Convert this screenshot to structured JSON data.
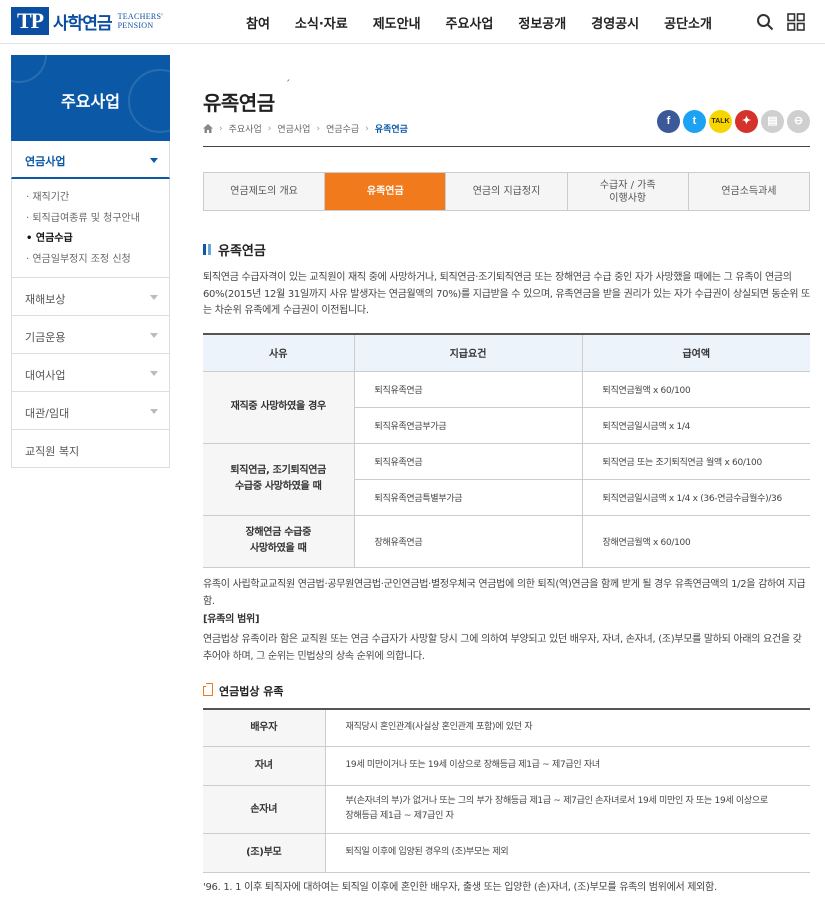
{
  "header": {
    "logo_mark": "TP",
    "logo_ko": "사학연금",
    "logo_en_1": "TEACHERS'",
    "logo_en_2": "PENSION",
    "nav": [
      "참여",
      "소식·자료",
      "제도안내",
      "주요사업",
      "정보공개",
      "경영공시",
      "공단소개"
    ]
  },
  "sidebar": {
    "title": "주요사업",
    "active_menu": "연금사업",
    "sub_items": [
      "· 재직기간",
      "· 퇴직급여종류 및 청구안내",
      "• 연금수급",
      "· 연금일부정지 조정 신청"
    ],
    "menus": [
      "재해보상",
      "기금운용",
      "대여사업",
      "대관/임대",
      "교직원 복지"
    ]
  },
  "page": {
    "title": "유족연금",
    "title_mark": "ˊ",
    "breadcrumb": [
      "주요사업",
      "연금사업",
      "연금수급",
      "유족연금"
    ]
  },
  "share": {
    "facebook": "f",
    "twitter": "t",
    "kakao": "TALK",
    "pdf": "✦",
    "print": "▤",
    "more": "⊖",
    "colors": {
      "facebook": "#3b5998",
      "twitter": "#1da1f2",
      "kakao": "#f7d600",
      "pdf": "#d4332c",
      "gray": "#cfcfcf"
    }
  },
  "tabs": [
    "연금제도의 개요",
    "유족연금",
    "연금의 지급정지",
    "수급자 / 가족\n이행사항",
    "연금소득과세"
  ],
  "section": {
    "title": "유족연금",
    "intro": "퇴직연금 수급자격이 있는 교직원이 재직 중에 사망하거나, 퇴직연금·조기퇴직연금 또는 장해연금 수급 중인 자가 사망했을 때에는 그 유족이 연금의 60%(2015년 12월 31일까지 사유 발생자는 연금월액의 70%)를 지급받을 수 있으며, 유족연금을 받을 권리가 있는 자가 수급권이 상실되면 동순위 또는 차순위 유족에게 수급권이 이전됩니다."
  },
  "table1": {
    "headers": [
      "사유",
      "지급요건",
      "급여액"
    ],
    "groups": [
      {
        "reason": "재직중 사망하였을 경우",
        "rows": [
          {
            "req": "퇴직유족연금",
            "amount": "퇴직연금월액 x 60/100"
          },
          {
            "req": "퇴직유족연금부가금",
            "amount": "퇴직연금일시금액 x 1/4"
          }
        ]
      },
      {
        "reason": "퇴직연금, 조기퇴직연금\n수급중 사망하였을 때",
        "rows": [
          {
            "req": "퇴직유족연금",
            "amount": "퇴직연금 또는 조기퇴직연금 월액 x 60/100"
          },
          {
            "req": "퇴직유족연금특별부가금",
            "amount": "퇴직연금일시금액 x 1/4 x (36-연금수급월수)/36"
          }
        ]
      },
      {
        "reason": "장해연금 수급중\n사망하였을 때",
        "rows": [
          {
            "req": "장해유족연금",
            "amount": "장해연금월액 x 60/100"
          }
        ]
      }
    ]
  },
  "notes": {
    "note1": "유족이 사립학교교직원 연금법·공무원연금법·군인연금법·별정우체국 연금법에 의한 퇴직(역)연금을 함께 받게 될 경우 유족연금액의 1/2을 감하여 지급함.",
    "scope_title": "[유족의 범위]",
    "scope_text": "연금법상 유족이라 함은 교직원 또는 연금 수급자가 사망할 당시 그에 의하여 부양되고 있던 배우자, 자녀, 손자녀, (조)부모를 말하되 아래의 요건을 갖추어야 하며, 그 순위는 민법상의 상속 순위에 의합니다."
  },
  "subsection": {
    "title": "연금법상 유족"
  },
  "table2": [
    {
      "label": "배우자",
      "desc": "재직당시 혼인관계(사실상 혼인관계 포함)에 있던 자"
    },
    {
      "label": "자녀",
      "desc": "19세 미만이거나 또는 19세 이상으로 장해등급 제1급 ~ 제7급인 자녀"
    },
    {
      "label": "손자녀",
      "desc": "부(손자녀의 부)가 없거나 또는 그의 부가 장해등급 제1급 ~ 제7급인 손자녀로서 19세 미만인 자 또는 19세 이상으로\n장해등급 제1급 ~ 제7급인 자"
    },
    {
      "label": "(조)부모",
      "desc": "퇴직일 이후에 입양된 경우의 (조)부모는 제외"
    }
  ],
  "footnote": "'96. 1. 1 이후 퇴직자에 대하여는 퇴직일 이후에 혼인한 배우자, 출생 또는 입양한 (손)자녀, (조)부모를 유족의 범위에서 제외함."
}
